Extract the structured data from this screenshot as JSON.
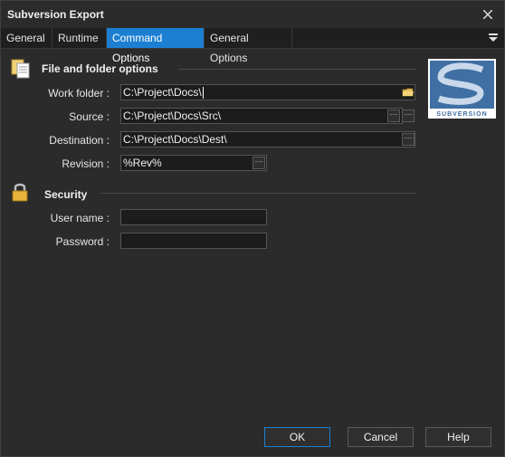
{
  "window": {
    "title": "Subversion Export"
  },
  "tabs": [
    {
      "label": "General"
    },
    {
      "label": "Runtime"
    },
    {
      "label": "Command Options"
    },
    {
      "label": "General Options"
    }
  ],
  "active_tab": "Command Options",
  "logo": {
    "text": "SUBVERSION"
  },
  "file_section": {
    "title": "File and folder options",
    "fields": {
      "work_folder": {
        "label": "Work folder :",
        "value": "C:\\Project\\Docs\\"
      },
      "source": {
        "label": "Source :",
        "value": "C:\\Project\\Docs\\Src\\"
      },
      "destination": {
        "label": "Destination :",
        "value": "C:\\Project\\Docs\\Dest\\"
      },
      "revision": {
        "label": "Revision :",
        "value": "%Rev%"
      }
    }
  },
  "security_section": {
    "title": "Security",
    "fields": {
      "user_name": {
        "label": "User name :",
        "value": ""
      },
      "password": {
        "label": "Password :",
        "value": ""
      }
    }
  },
  "buttons": {
    "ok": "OK",
    "cancel": "Cancel",
    "help": "Help"
  },
  "colors": {
    "accent": "#1c7fd1",
    "background": "#2b2b2b"
  }
}
